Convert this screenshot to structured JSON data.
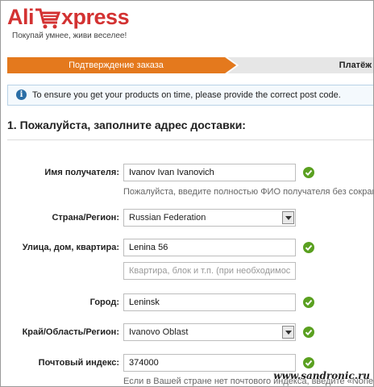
{
  "header": {
    "logo_left": "Ali",
    "logo_right": "xpress",
    "tagline": "Покупай умнее, живи веселее!"
  },
  "steps": {
    "active": "Подтверждение заказа",
    "next": "Платёж"
  },
  "notice": "To ensure you get your products on time, please provide the correct post code.",
  "section_title": "1. Пожалуйста, заполните адрес доставки:",
  "form": {
    "recipient_label": "Имя получателя:",
    "recipient_value": "Ivanov Ivan Ivanovich",
    "recipient_hint": "Пожалуйста, введите полностью ФИО получателя без сокраще",
    "country_label": "Страна/Регион:",
    "country_value": "Russian Federation",
    "street_label": "Улица, дом, квартира:",
    "street_value": "Lenina 56",
    "street2_placeholder": "Квартира, блок и т.п. (при необходимости)",
    "city_label": "Город:",
    "city_value": "Leninsk",
    "region_label": "Край/Область/Регион:",
    "region_value": "Ivanovo Oblast",
    "zip_label": "Почтовый индекс:",
    "zip_value": "374000",
    "zip_hint": "Если в Вашей стране нет почтового индекса, введите «None»"
  },
  "watermark": "www.sandronic.ru",
  "colors": {
    "brand": "#d33232",
    "step_active": "#e4791d",
    "ok": "#5aa020",
    "info": "#2a6ea6"
  }
}
